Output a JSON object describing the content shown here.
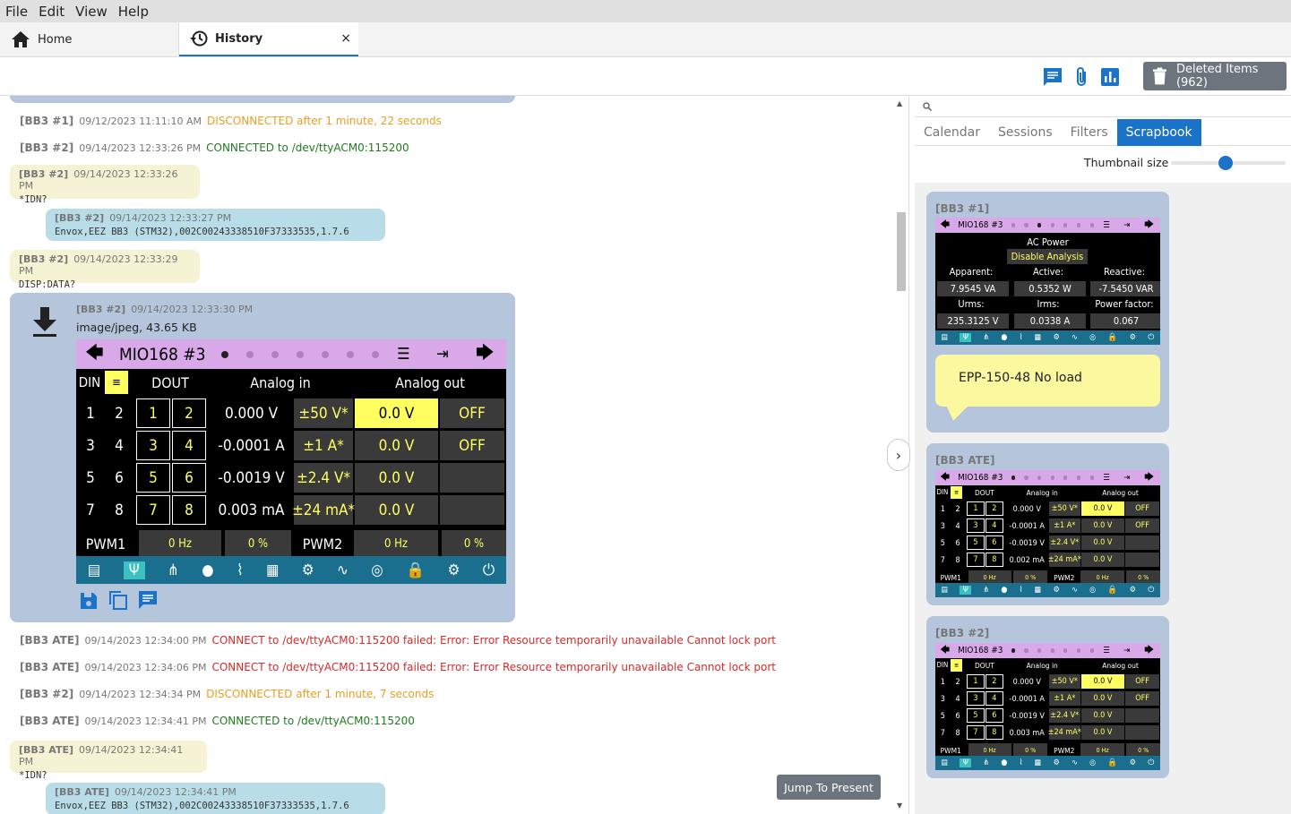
{
  "menu": [
    "File",
    "Edit",
    "View",
    "Help"
  ],
  "tabs": {
    "home": "Home",
    "history": "History",
    "close": "×"
  },
  "toolbar": {
    "deleted_items": "Deleted Items (962)"
  },
  "history": [
    {
      "source": "[BB3 #1]",
      "time": "09/12/2023 11:11:10 AM",
      "text": "DISCONNECTED after 1 minute, 22 seconds",
      "kind": "orange"
    },
    {
      "source": "[BB3 #2]",
      "time": "09/14/2023 12:33:26 PM",
      "text": "CONNECTED to /dev/ttyACM0:115200",
      "kind": "green"
    },
    {
      "source": "[BB3 #2]",
      "time": "09/14/2023 12:33:26 PM",
      "text": "*IDN?",
      "kind": "request"
    },
    {
      "source": "[BB3 #2]",
      "time": "09/14/2023 12:33:27 PM",
      "text": "Envox,EEZ BB3 (STM32),002C00243338510F37333535,1.7.6",
      "kind": "answer"
    },
    {
      "source": "[BB3 #2]",
      "time": "09/14/2023 12:33:29 PM",
      "text": "DISP:DATA?",
      "kind": "request"
    },
    {
      "source": "[BB3 #2]",
      "time": "09/14/2023 12:33:30 PM",
      "text": "image/jpeg, 43.65 KB",
      "kind": "image"
    },
    {
      "source": "[BB3 ATE]",
      "time": "09/14/2023 12:34:00 PM",
      "text": "CONNECT to /dev/ttyACM0:115200 failed: Error: Error Resource temporarily unavailable Cannot lock port",
      "kind": "red"
    },
    {
      "source": "[BB3 ATE]",
      "time": "09/14/2023 12:34:06 PM",
      "text": "CONNECT to /dev/ttyACM0:115200 failed: Error: Error Resource temporarily unavailable Cannot lock port",
      "kind": "red"
    },
    {
      "source": "[BB3 #2]",
      "time": "09/14/2023 12:34:34 PM",
      "text": "DISCONNECTED after 1 minute, 7 seconds",
      "kind": "orange"
    },
    {
      "source": "[BB3 ATE]",
      "time": "09/14/2023 12:34:41 PM",
      "text": "CONNECTED to /dev/ttyACM0:115200",
      "kind": "green"
    },
    {
      "source": "[BB3 ATE]",
      "time": "09/14/2023 12:34:41 PM",
      "text": "*IDN?",
      "kind": "request"
    },
    {
      "source": "[BB3 ATE]",
      "time": "09/14/2023 12:34:41 PM",
      "text": "Envox,EEZ BB3 (STM32),002C00243338510F37333535,1.7.6",
      "kind": "answer"
    }
  ],
  "display": {
    "module": "MIO168 #3",
    "headers": {
      "din": "DIN",
      "dout": "DOUT",
      "ain": "Analog in",
      "aout": "Analog out"
    },
    "rows": [
      {
        "din": [
          "1",
          "2"
        ],
        "dout": [
          "1",
          "2"
        ],
        "ain": "0.000 V",
        "range": "±50 V*",
        "aout": "0.0 V",
        "state": "OFF"
      },
      {
        "din": [
          "3",
          "4"
        ],
        "dout": [
          "3",
          "4"
        ],
        "ain": "-0.0001 A",
        "range": "±1 A*",
        "aout": "0.0 V",
        "state": "OFF"
      },
      {
        "din": [
          "5",
          "6"
        ],
        "dout": [
          "5",
          "6"
        ],
        "ain": "-0.0019 V",
        "range": "±2.4 V*",
        "aout": "0.0 V",
        "state": ""
      },
      {
        "din": [
          "7",
          "8"
        ],
        "dout": [
          "7",
          "8"
        ],
        "ain": "0.003 mA",
        "range": "±24 mA*",
        "aout": "0.0 V",
        "state": ""
      }
    ],
    "pwm": {
      "pwm1": "PWM1",
      "f1": "0 Hz",
      "d1": "0 %",
      "pwm2": "PWM2",
      "f2": "0 Hz",
      "d2": "0 %"
    }
  },
  "jump": "Jump To Present",
  "panel": {
    "tabs": [
      "Calendar",
      "Sessions",
      "Filters",
      "Scrapbook"
    ],
    "active_tab": "Scrapbook",
    "thumbnail_label": "Thumbnail size",
    "thumbnail_size": 0.48,
    "cards": [
      {
        "title": "[BB3 #1]",
        "kind": "ac"
      },
      {
        "title": "[BB3 ATE]",
        "kind": "mio"
      },
      {
        "title": "[BB3 #2]",
        "kind": "mio"
      }
    ],
    "ac": {
      "title": "AC Power",
      "button": "Disable Analysis",
      "labels": [
        "Apparent:",
        "Active:",
        "Reactive:",
        "Urms:",
        "Irms:",
        "Power factor:"
      ],
      "values": [
        "7.9545 VA",
        "0.5352 W",
        "-7.5450 VAR",
        "235.3125 V",
        "0.0338 A",
        "0.067"
      ]
    },
    "note": "EPP-150-48 No load",
    "thumb_rows": [
      [
        {
          "ain": "0.000 V",
          "range": "±50 V*",
          "aout": "0.0 V",
          "state": "OFF"
        },
        {
          "ain": "-0.0001 A",
          "range": "±1 A*",
          "aout": "0.0 V",
          "state": "OFF"
        },
        {
          "ain": "-0.0019 V",
          "range": "±2.4 V*",
          "aout": "0.0 V",
          "state": ""
        },
        {
          "ain": "0.002 mA",
          "range": "±24 mA*",
          "aout": "0.0 V",
          "state": ""
        }
      ],
      [
        {
          "ain": "0.000 V",
          "range": "±50 V*",
          "aout": "0.0 V",
          "state": "OFF"
        },
        {
          "ain": "-0.0001 A",
          "range": "±1 A*",
          "aout": "0.0 V",
          "state": "OFF"
        },
        {
          "ain": "-0.0019 V",
          "range": "±2.4 V*",
          "aout": "0.0 V",
          "state": ""
        },
        {
          "ain": "0.003 mA",
          "range": "±24 mA*",
          "aout": "0.0 V",
          "state": ""
        }
      ]
    ]
  },
  "colors": {
    "accent": "#1a73c8",
    "orange": "#e6a020",
    "green": "#1f7a1f",
    "red": "#d42b2b",
    "display_header": "#d9a8e8",
    "display_footer": "#1b6f8e"
  }
}
